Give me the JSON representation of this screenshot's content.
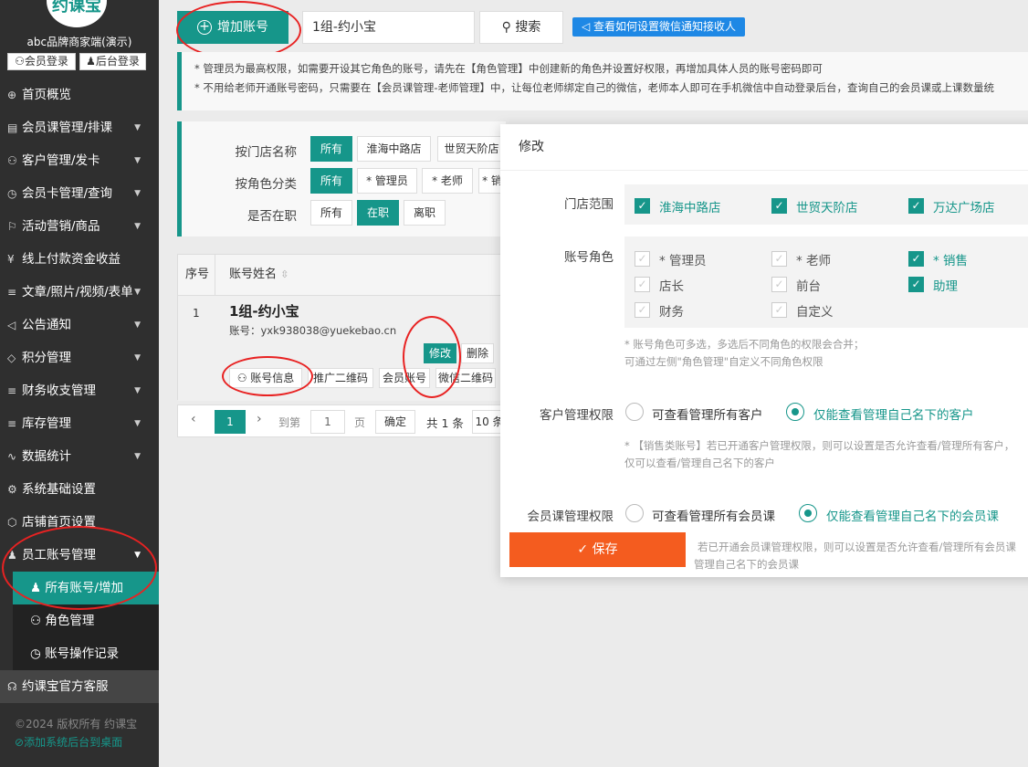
{
  "sidebar": {
    "logo_text": "约课宝",
    "brand": "abc品牌商家端(演示)",
    "member_login": "会员登录",
    "admin_login": "后台登录",
    "items": [
      {
        "label": "首页概览",
        "icon": "globe-icon"
      },
      {
        "label": "会员课管理/排课",
        "icon": "document-icon"
      },
      {
        "label": "客户管理/发卡",
        "icon": "user-icon"
      },
      {
        "label": "会员卡管理/查询",
        "icon": "clock-icon"
      },
      {
        "label": "活动营销/商品",
        "icon": "flag-icon"
      },
      {
        "label": "线上付款资金收益",
        "icon": "yen-icon"
      },
      {
        "label": "文章/照片/视频/表单",
        "icon": "sliders-icon"
      },
      {
        "label": "公告通知",
        "icon": "speaker-icon"
      },
      {
        "label": "积分管理",
        "icon": "diamond-icon"
      },
      {
        "label": "财务收支管理",
        "icon": "sliders-icon"
      },
      {
        "label": "库存管理",
        "icon": "sliders-icon"
      },
      {
        "label": "数据统计",
        "icon": "pulse-icon"
      },
      {
        "label": "系统基础设置",
        "icon": "gear-icon"
      },
      {
        "label": "店铺首页设置",
        "icon": "cube-icon"
      },
      {
        "label": "员工账号管理",
        "icon": "person-icon"
      }
    ],
    "subitems": [
      {
        "label": "所有账号/增加",
        "icon": "person-icon"
      },
      {
        "label": "角色管理",
        "icon": "group-icon"
      },
      {
        "label": "账号操作记录",
        "icon": "clock-icon"
      }
    ],
    "service": "约课宝官方客服",
    "copyright": "©2024 版权所有 约课宝",
    "add_desktop": "添加系统后台到桌面"
  },
  "toolbar": {
    "add_label": "增加账号",
    "search_value": "1组-约小宝",
    "search_label": "搜索",
    "wechat_label": "查看如何设置微信通知接收人"
  },
  "notice": {
    "line1": "* 管理员为最高权限，如需要开设其它角色的账号，请先在【角色管理】中创建新的角色并设置好权限，再增加具体人员的账号密码即可",
    "line2": "* 不用给老师开通账号密码，只需要在【会员课管理-老师管理】中，让每位老师绑定自己的微信，老师本人即可在手机微信中自动登录后台，查询自己的会员课或上课数量统"
  },
  "filters": {
    "store_label": "按门店名称",
    "store_options": [
      "所有",
      "淮海中路店",
      "世贸天阶店"
    ],
    "role_label": "按角色分类",
    "role_options": [
      "所有",
      "* 管理员",
      "* 老师",
      "* 销"
    ],
    "status_label": "是否在职",
    "status_options": [
      "所有",
      "在职",
      "离职"
    ]
  },
  "table": {
    "col_index": "序号",
    "col_name": "账号姓名",
    "row": {
      "index": "1",
      "name": "1组-约小宝",
      "account": "账号：yxk938038@yuekebao.cn",
      "edit": "修改",
      "delete": "删除",
      "info": "账号信息",
      "qr_promo": "推广二维码",
      "member_account": "会员账号",
      "wechat_qr": "微信二维码"
    }
  },
  "pager": {
    "current": "1",
    "goto_label": "到第",
    "goto_value": "1",
    "page_unit": "页",
    "confirm": "确定",
    "total": "共 1 条",
    "per_page": "10 条"
  },
  "modal": {
    "title": "修改",
    "store_label": "门店范围",
    "stores": [
      {
        "label": "淮海中路店",
        "checked": true
      },
      {
        "label": "世贸天阶店",
        "checked": true
      },
      {
        "label": "万达广场店",
        "checked": true
      }
    ],
    "role_label": "账号角色",
    "roles": [
      {
        "label": "* 管理员",
        "checked": false
      },
      {
        "label": "* 老师",
        "checked": false
      },
      {
        "label": "* 销售",
        "checked": true
      },
      {
        "label": "店长",
        "checked": false
      },
      {
        "label": "前台",
        "checked": false
      },
      {
        "label": "助理",
        "checked": true
      },
      {
        "label": "财务",
        "checked": false
      },
      {
        "label": "自定义",
        "checked": false
      }
    ],
    "role_hint1": "* 账号角色可多选，多选后不同角色的权限会合并；",
    "role_hint2": "可通过左侧\"角色管理\"自定义不同角色权限",
    "customer_label": "客户管理权限",
    "customer_opt1": "可查看管理所有客户",
    "customer_opt2": "仅能查看管理自己名下的客户",
    "customer_hint1": "* 【销售类账号】若已开通客户管理权限，则可以设置是否允许查看/管理所有客户，",
    "customer_hint2": "仅可以查看/管理自己名下的客户",
    "course_label": "会员课管理权限",
    "course_opt1": "可查看管理所有会员课",
    "course_opt2": "仅能查看管理自己名下的会员课",
    "course_hint1": "若已开通会员课管理权限，则可以设置是否允许查看/管理所有会员课",
    "course_hint2": "管理自己名下的会员课",
    "save": "保存"
  },
  "colors": {
    "accent": "#16968a",
    "save": "#f45c1f",
    "sidebar": "#2f2f2f",
    "annotation": "#e82222"
  }
}
